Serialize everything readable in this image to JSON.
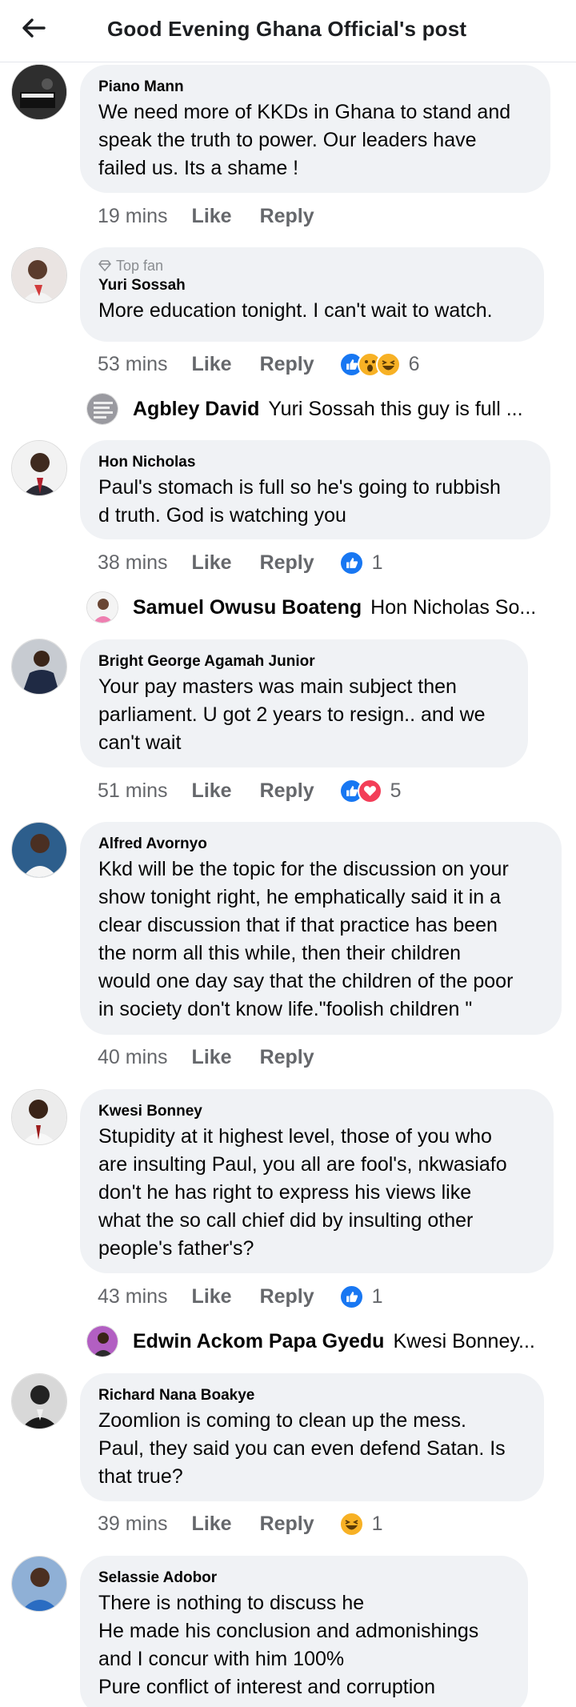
{
  "header": {
    "title": "Good Evening Ghana Official's post"
  },
  "actions": {
    "like": "Like",
    "reply": "Reply"
  },
  "comments": [
    {
      "name": "Piano Mann",
      "text": [
        "We need more of KKDs in Ghana to stand and",
        "speak the truth to power. Our leaders have",
        "failed us. Its a shame !"
      ],
      "time": "19 mins"
    },
    {
      "badge": "Top fan",
      "name": "Yuri Sossah",
      "text": [
        "More education tonight. I can't wait to watch."
      ],
      "time": "53 mins",
      "reaction_count": "6",
      "reply": {
        "name": "Agbley David",
        "text": "Yuri Sossah this guy is full ..."
      }
    },
    {
      "name": "Hon Nicholas",
      "text": [
        "Paul's stomach is full so he's going to rubbish",
        "d truth. God is watching you"
      ],
      "time": "38 mins",
      "reaction_count": "1",
      "reply": {
        "name": "Samuel Owusu Boateng",
        "text": "Hon Nicholas So..."
      }
    },
    {
      "name": "Bright George Agamah Junior",
      "text": [
        "Your pay masters was main subject then",
        "parliament. U got 2 years to resign.. and we",
        "can't wait"
      ],
      "time": "51 mins",
      "reaction_count": "5"
    },
    {
      "name": "Alfred Avornyo",
      "text": [
        "Kkd will be the topic for the discussion on your",
        "show tonight right,  he emphatically said it in a",
        "clear discussion that if that practice has been",
        "the norm  all this while,  then their children",
        "would one day say that the children of the poor",
        "in society don't know life.\"foolish children \""
      ],
      "time": "40 mins"
    },
    {
      "name": "Kwesi Bonney",
      "text": [
        "Stupidity at it highest level, those of you who",
        "are insulting Paul, you all are fool's, nkwasiafo",
        "don't he has right to express his views like",
        "what the so call chief did by insulting other",
        "people's father's?"
      ],
      "time": "43 mins",
      "reaction_count": "1",
      "reply": {
        "name": "Edwin Ackom Papa Gyedu",
        "text": "Kwesi Bonney..."
      }
    },
    {
      "name": "Richard Nana Boakye",
      "text": [
        "Zoomlion is coming to clean up the mess.",
        "Paul, they said you can even defend Satan. Is",
        "that true?"
      ],
      "time": "39 mins",
      "reaction_count": "1"
    },
    {
      "name": "Selassie Adobor",
      "text": [
        "There is nothing to discuss he",
        "He made his conclusion and admonishings",
        "and I concur with him 100%",
        "Pure conflict of interest and corruption"
      ]
    }
  ]
}
